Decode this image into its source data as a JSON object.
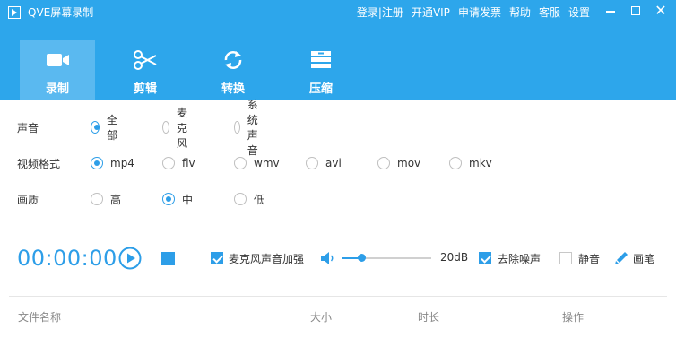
{
  "app": {
    "title": "QVE屏幕录制"
  },
  "top_menu": [
    "登录|注册",
    "开通VIP",
    "申请发票",
    "帮助",
    "客服",
    "设置"
  ],
  "tabs": [
    {
      "label": "录制",
      "icon": "video-camera-icon",
      "active": true
    },
    {
      "label": "剪辑",
      "icon": "scissors-icon",
      "active": false
    },
    {
      "label": "转换",
      "icon": "refresh-icon",
      "active": false
    },
    {
      "label": "压缩",
      "icon": "archive-icon",
      "active": false
    }
  ],
  "options": {
    "audio": {
      "label": "声音",
      "choices": [
        "全部",
        "麦克风",
        "系统声音"
      ],
      "selected": 0
    },
    "format": {
      "label": "视频格式",
      "choices": [
        "mp4",
        "flv",
        "wmv",
        "avi",
        "mov",
        "mkv"
      ],
      "selected": 0
    },
    "quality": {
      "label": "画质",
      "choices": [
        "高",
        "中",
        "低"
      ],
      "selected": 1
    }
  },
  "controls": {
    "timer": "00:00:00",
    "mic_boost": {
      "label": "麦克风声音加强",
      "checked": true
    },
    "volume": {
      "value": "20dB",
      "level": 0.22
    },
    "noise_reduction": {
      "label": "去除噪声",
      "checked": true
    },
    "mute": {
      "label": "静音",
      "checked": false
    },
    "pen": {
      "label": "画笔"
    }
  },
  "table": {
    "headers": [
      "文件名称",
      "大小",
      "时长",
      "操作"
    ]
  },
  "colors": {
    "primary": "#2da6eb",
    "accent": "#2d9ee8"
  }
}
